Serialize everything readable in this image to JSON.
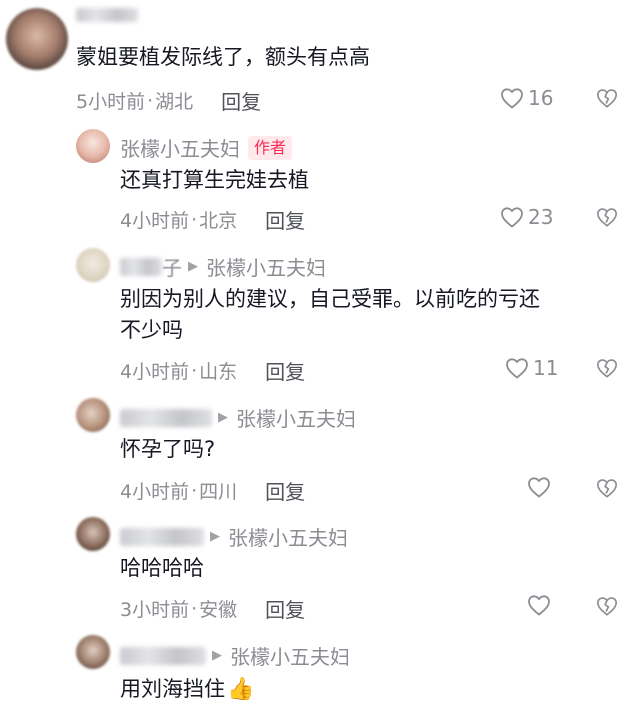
{
  "comments": [
    {
      "name": "",
      "text": "蒙姐要植发际线了，额头有点高",
      "time": "5小时前",
      "location": "湖北",
      "reply_label": "回复",
      "likes": "16"
    },
    {
      "name": "张檬小五夫妇",
      "badge": "作者",
      "text": "还真打算生完娃去植",
      "time": "4小时前",
      "location": "北京",
      "reply_label": "回复",
      "likes": "23"
    },
    {
      "name_tail": "子",
      "reply_to": "张檬小五夫妇",
      "text_line1": "别因为别人的建议，自己受罪。以前吃的亏还",
      "text_line2": "不少吗",
      "time": "4小时前",
      "location": "山东",
      "reply_label": "回复",
      "likes": "11"
    },
    {
      "reply_to": "张檬小五夫妇",
      "text": "怀孕了吗?",
      "time": "4小时前",
      "location": "四川",
      "reply_label": "回复",
      "likes": ""
    },
    {
      "reply_to": "张檬小五夫妇",
      "text": "哈哈哈哈",
      "time": "3小时前",
      "location": "安徽",
      "reply_label": "回复",
      "likes": ""
    },
    {
      "reply_to": "张檬小五夫妇",
      "text": "用刘海挡住",
      "emoji": "👍"
    }
  ],
  "separator": "·",
  "colors": {
    "text": "#161823",
    "meta": "#8b8d93",
    "accent": "#fe2c55"
  },
  "icons": {
    "like": "heart-outline-icon",
    "dislike": "broken-heart-icon",
    "arrow": "triangle-right-icon"
  }
}
